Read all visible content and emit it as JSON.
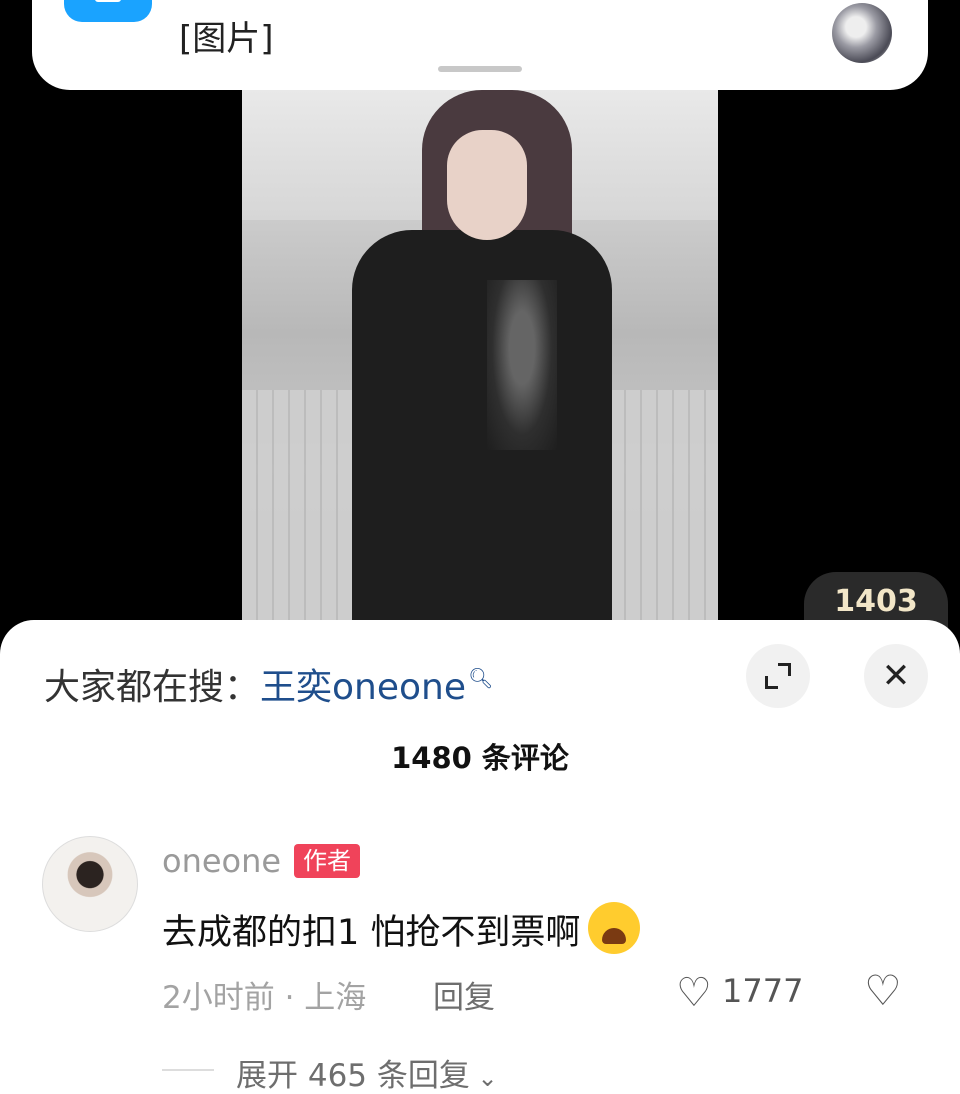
{
  "notification": {
    "text": "[图片]"
  },
  "image_badge": {
    "count": "1403"
  },
  "comments_sheet": {
    "search_prefix": "大家都在搜：",
    "search_term": "王奕oneone",
    "comment_count_label": "1480 条评论",
    "comments": [
      {
        "username": "oneone",
        "badge": "作者",
        "text": "去成都的扣1 怕抢不到票啊",
        "time": "2小时前",
        "location": "上海",
        "meta": "2小时前 · 上海",
        "reply_label": "回复",
        "likes": "1777",
        "expand_replies": "展开 465 条回复"
      }
    ]
  },
  "icons": {
    "search": "search-icon",
    "expand": "expand-icon",
    "close": "close-icon",
    "like": "heart-outline-icon",
    "dislike": "broken-heart-icon",
    "emoji": "crying-face-emoji"
  },
  "colors": {
    "app_icon": "#1aa3ff",
    "search_term": "#1f4e8c",
    "author_badge": "#f0435a"
  }
}
